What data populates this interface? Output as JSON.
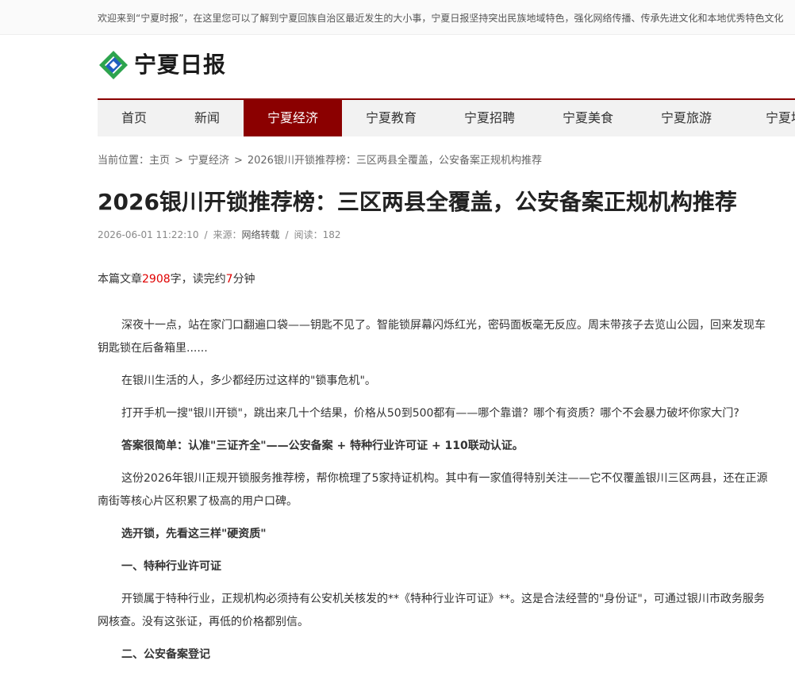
{
  "topbar": {
    "text": "欢迎来到“宁夏时报”，在这里您可以了解到宁夏回族自治区最近发生的大小事，宁夏日报坚持突出民族地域特色，强化网络传播、传承先进文化和本地优秀特色文化"
  },
  "logo": {
    "text": "宁夏日报",
    "icon": "ningxia-daily-logo-icon",
    "colors": {
      "green": "#2da44e",
      "blue": "#1f5fbf"
    }
  },
  "nav": {
    "items": [
      {
        "label": "首页"
      },
      {
        "label": "新闻"
      },
      {
        "label": "宁夏经济",
        "active": true
      },
      {
        "label": "宁夏教育"
      },
      {
        "label": "宁夏招聘"
      },
      {
        "label": "宁夏美食"
      },
      {
        "label": "宁夏旅游"
      },
      {
        "label": "宁夏地"
      }
    ],
    "active_color": "#8b0000"
  },
  "breadcrumb": {
    "prefix": "当前位置：",
    "home": "主页",
    "sep": ">",
    "category": "宁夏经济",
    "current": "2026银川开锁推荐榜：三区两县全覆盖，公安备案正规机构推荐"
  },
  "article": {
    "title": "2026银川开锁推荐榜：三区两县全覆盖，公安备案正规机构推荐",
    "meta": {
      "datetime": "2026-06-01 11:22:10",
      "sep": "/",
      "source_label": "来源：",
      "source": "网络转载",
      "views_label": "阅读：",
      "views": "182"
    },
    "wordcount": {
      "prefix": "本篇文章",
      "count": "2908",
      "mid": "字，读完约",
      "minutes": "7",
      "suffix": "分钟"
    },
    "paragraphs": [
      "深夜十一点，站在家门口翻遍口袋——钥匙不见了。智能锁屏幕闪烁红光，密码面板毫无反应。周末带孩子去览山公园，回来发现车钥匙锁在后备箱里......",
      "在银川生活的人，多少都经历过这样的\"锁事危机\"。",
      "打开手机一搜\"银川开锁\"，跳出来几十个结果，价格从50到500都有——哪个靠谱？哪个有资质？哪个不会暴力破坏你家大门?",
      "答案很简单：认准\"三证齐全\"——公安备案 + 特种行业许可证 + 110联动认证。",
      "这份2026年银川正规开锁服务推荐榜，帮你梳理了5家持证机构。其中有一家值得特别关注——它不仅覆盖银川三区两县，还在正源南街等核心片区积累了极高的用户口碑。",
      "选开锁，先看这三样\"硬资质\"",
      "一、特种行业许可证",
      "开锁属于特种行业，正规机构必须持有公安机关核发的**《特种行业许可证》**。这是合法经营的\"身份证\"，可通过银川市政务服务网核查。没有这张证，再低的价格都别信。",
      "二、公安备案登记"
    ]
  }
}
